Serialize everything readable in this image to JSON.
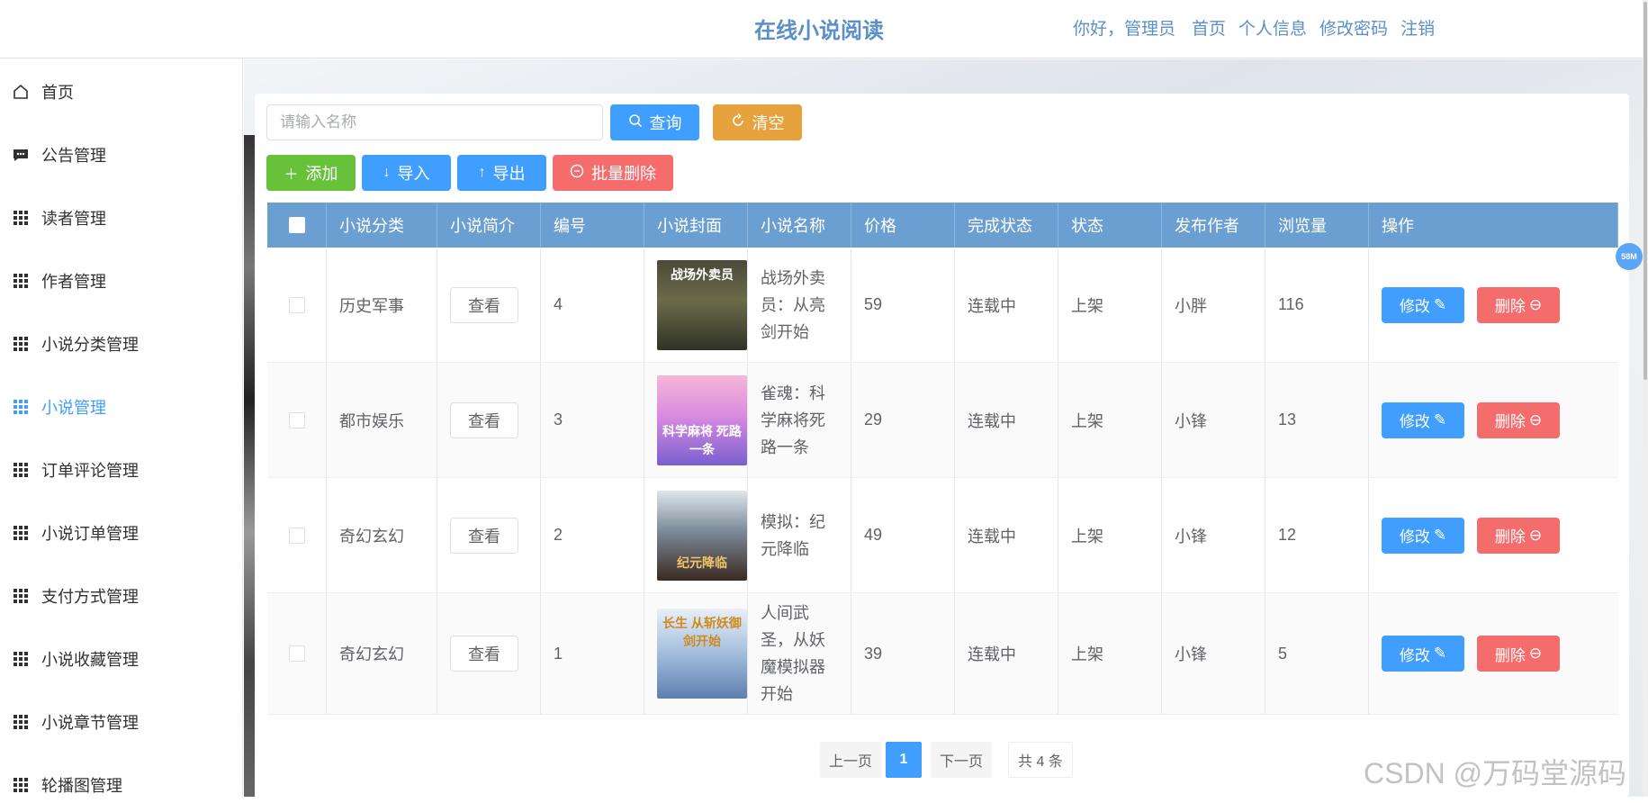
{
  "header": {
    "title": "在线小说阅读",
    "greeting": "你好，管理员",
    "nav": [
      "首页",
      "个人信息",
      "修改密码",
      "注销"
    ]
  },
  "sidebar": {
    "items": [
      {
        "label": "首页",
        "icon": "home-icon"
      },
      {
        "label": "公告管理",
        "icon": "chat-icon"
      },
      {
        "label": "读者管理",
        "icon": "grid-icon"
      },
      {
        "label": "作者管理",
        "icon": "grid-icon"
      },
      {
        "label": "小说分类管理",
        "icon": "grid-icon"
      },
      {
        "label": "小说管理",
        "icon": "grid-icon",
        "active": true
      },
      {
        "label": "订单评论管理",
        "icon": "grid-icon"
      },
      {
        "label": "小说订单管理",
        "icon": "grid-icon"
      },
      {
        "label": "支付方式管理",
        "icon": "grid-icon"
      },
      {
        "label": "小说收藏管理",
        "icon": "grid-icon"
      },
      {
        "label": "小说章节管理",
        "icon": "grid-icon"
      },
      {
        "label": "轮播图管理",
        "icon": "grid-icon"
      }
    ]
  },
  "search": {
    "placeholder": "请输入名称",
    "value": ""
  },
  "toolbar": {
    "query": "查询",
    "clear": "清空",
    "add": "添加",
    "import": "导入",
    "export": "导出",
    "batch_delete": "批量删除"
  },
  "table": {
    "headers": [
      "小说分类",
      "小说简介",
      "编号",
      "小说封面",
      "小说名称",
      "价格",
      "完成状态",
      "状态",
      "发布作者",
      "浏览量",
      "操作"
    ],
    "view_label": "查看",
    "edit_label": "修改",
    "delete_label": "删除",
    "rows": [
      {
        "category": "历史军事",
        "id": "4",
        "cover_title": "战场外卖员",
        "name": "战场外卖员：从亮剑开始",
        "price": "59",
        "completion": "连载中",
        "status": "上架",
        "author": "小胖",
        "views": "116"
      },
      {
        "category": "都市娱乐",
        "id": "3",
        "cover_title": "科学麻将 死路一条",
        "name": "雀魂：科学麻将死路一条",
        "price": "29",
        "completion": "连载中",
        "status": "上架",
        "author": "小锋",
        "views": "13"
      },
      {
        "category": "奇幻玄幻",
        "id": "2",
        "cover_title": "纪元降临",
        "name": "模拟：纪元降临",
        "price": "49",
        "completion": "连载中",
        "status": "上架",
        "author": "小锋",
        "views": "12"
      },
      {
        "category": "奇幻玄幻",
        "id": "1",
        "cover_title": "长生 从斩妖御剑开始",
        "name": "人间武圣，从妖魔模拟器开始",
        "price": "39",
        "completion": "连载中",
        "status": "上架",
        "author": "小锋",
        "views": "5"
      }
    ]
  },
  "pagination": {
    "prev": "上一页",
    "current": "1",
    "next": "下一页",
    "total": "共 4 条"
  },
  "float_badge": "58M",
  "watermark": "CSDN @万码堂源码",
  "colors": {
    "accent": "#409eff",
    "header_title": "#5b8fc9",
    "table_header": "#6c9fd1",
    "danger": "#f56c6c",
    "warning": "#e6a23c",
    "success": "#67c23a"
  }
}
